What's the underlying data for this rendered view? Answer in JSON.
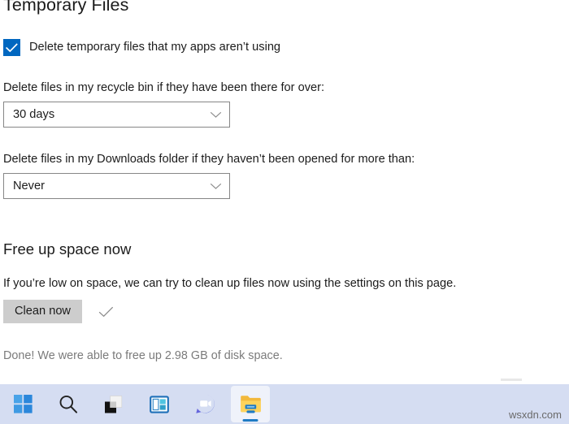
{
  "page": {
    "title": "Temporary Files"
  },
  "temporary_files": {
    "checkbox": {
      "label": "Delete temporary files that my apps aren’t using",
      "checked": true,
      "accent_color": "#0067c0",
      "icon": "check-icon"
    },
    "recycle_bin": {
      "label": "Delete files in my recycle bin if they have been there for over:",
      "value": "30 days",
      "chevron_icon": "chevron-down-icon"
    },
    "downloads": {
      "label": "Delete files in my Downloads folder if they haven’t been opened for more than:",
      "value": "Never",
      "chevron_icon": "chevron-down-icon"
    }
  },
  "free_up_space": {
    "title": "Free up space now",
    "description": "If you’re low on space, we can try to clean up files now using the settings on this page.",
    "button_label": "Clean now",
    "button_bg": "#cdcdcd",
    "done_icon": "check-icon",
    "status": "Done! We were able to free up 2.98 GB of disk space.",
    "status_color": "#7b7b7b"
  },
  "taskbar": {
    "background": "#d5ddf2",
    "items": [
      {
        "name": "start",
        "icon": "windows-logo-icon",
        "active": false
      },
      {
        "name": "search",
        "icon": "search-icon",
        "active": false
      },
      {
        "name": "widgets",
        "icon": "widgets-icon",
        "active": false
      },
      {
        "name": "task-view",
        "icon": "task-view-icon",
        "active": false
      },
      {
        "name": "chat",
        "icon": "chat-video-icon",
        "active": false
      },
      {
        "name": "file-explorer",
        "icon": "folder-icon",
        "active": true
      }
    ]
  },
  "watermark": {
    "text": "wsxdn.com"
  }
}
